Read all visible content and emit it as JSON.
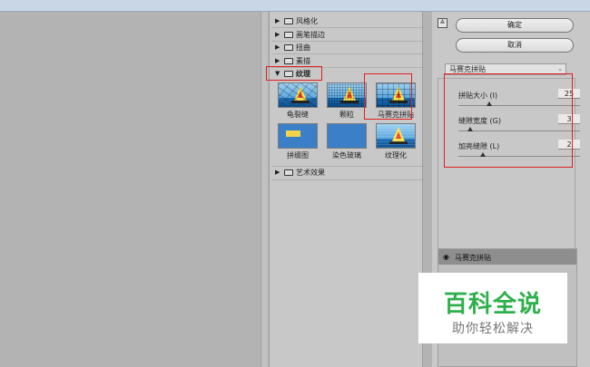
{
  "gallery": {
    "folders_top": [
      {
        "label": "风格化",
        "expanded": false
      },
      {
        "label": "画笔描边",
        "expanded": false
      },
      {
        "label": "扭曲",
        "expanded": false
      },
      {
        "label": "素描",
        "expanded": false
      }
    ],
    "texture_folder": {
      "label": "纹理",
      "expanded": true
    },
    "filters": [
      {
        "label": "龟裂缝",
        "selected": false,
        "icon": "craquelure-thumb"
      },
      {
        "label": "颗粒",
        "selected": false,
        "icon": "grain-thumb"
      },
      {
        "label": "马赛克拼贴",
        "selected": true,
        "icon": "mosaic-tiles-thumb"
      },
      {
        "label": "拼缀图",
        "selected": false,
        "icon": "patchwork-thumb"
      },
      {
        "label": "染色玻璃",
        "selected": false,
        "icon": "stained-glass-thumb"
      },
      {
        "label": "纹理化",
        "selected": false,
        "icon": "texturizer-thumb"
      }
    ],
    "folders_bottom": [
      {
        "label": "艺术效果",
        "expanded": false
      }
    ]
  },
  "controls": {
    "collapse_symbol": "≙",
    "ok_label": "确定",
    "cancel_label": "取消",
    "filter_select": "马赛克拼贴",
    "params": [
      {
        "label": "拼贴大小 (I)",
        "value": "25",
        "level": 0.25
      },
      {
        "label": "缝隙宽度 (G)",
        "value": "3",
        "level": 0.1
      },
      {
        "label": "加亮缝隙 (L)",
        "value": "2",
        "level": 0.2
      }
    ]
  },
  "layers": {
    "items": [
      {
        "label": "马赛克拼贴",
        "visible": true
      }
    ]
  },
  "watermark": {
    "title": "百科全说",
    "subtitle": "助你轻松解决"
  },
  "colors": {
    "highlight": "#e02020",
    "panel_bg": "#c8c8c8",
    "preview_bg": "#b3b3b3",
    "watermark_green": "#2db04b"
  }
}
